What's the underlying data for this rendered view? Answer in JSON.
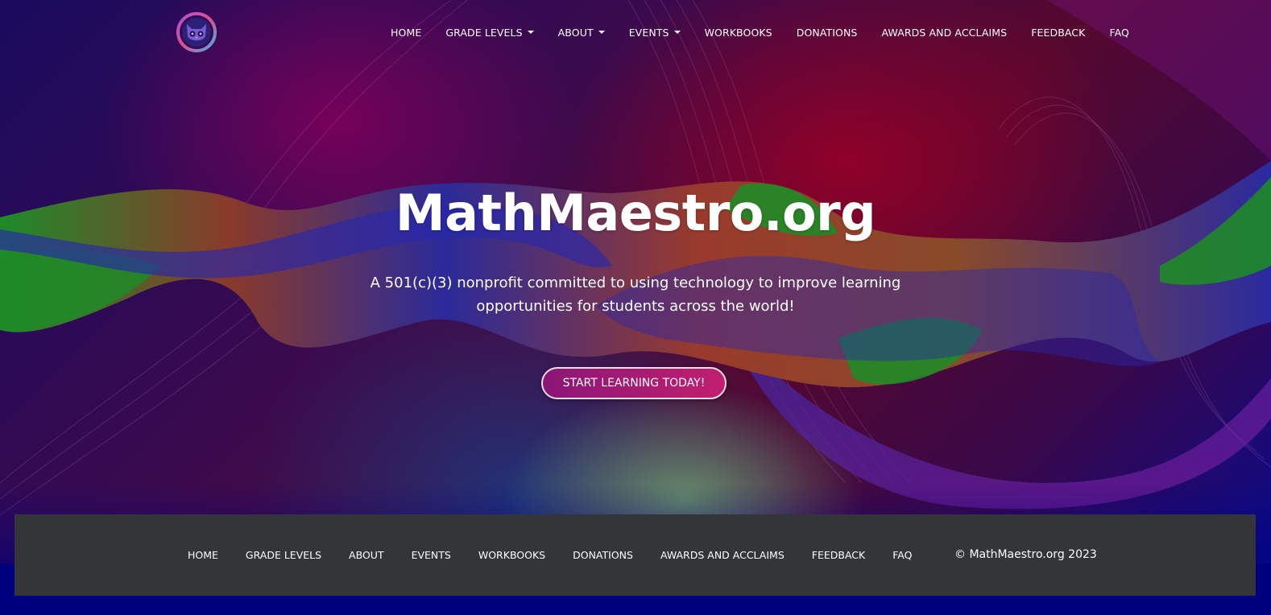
{
  "brand": {
    "logo_icon": "owl-logo-icon",
    "colors": {
      "accent": "#b3196f",
      "footer_bg": "#343538",
      "page_bg": "#00007f"
    }
  },
  "topnav": {
    "items": [
      {
        "label": "HOME",
        "dropdown": false
      },
      {
        "label": "GRADE LEVELS",
        "dropdown": true
      },
      {
        "label": "ABOUT",
        "dropdown": true
      },
      {
        "label": "EVENTS",
        "dropdown": true
      },
      {
        "label": "WORKBOOKS",
        "dropdown": false
      },
      {
        "label": "DONATIONS",
        "dropdown": false
      },
      {
        "label": "AWARDS AND ACCLAIMS",
        "dropdown": false
      },
      {
        "label": "FEEDBACK",
        "dropdown": false
      },
      {
        "label": "FAQ",
        "dropdown": false
      }
    ]
  },
  "hero": {
    "title": "MathMaestro.org",
    "subtitle": "A 501(c)(3) nonprofit committed to using technology to improve learning opportunities for students across the world!",
    "cta_label": "START LEARNING TODAY!"
  },
  "footer": {
    "items": [
      {
        "label": "HOME"
      },
      {
        "label": "GRADE LEVELS"
      },
      {
        "label": "ABOUT"
      },
      {
        "label": "EVENTS"
      },
      {
        "label": "WORKBOOKS"
      },
      {
        "label": "DONATIONS"
      },
      {
        "label": "AWARDS AND ACCLAIMS"
      },
      {
        "label": "FEEDBACK"
      },
      {
        "label": "FAQ"
      }
    ],
    "copyright": "© MathMaestro.org 2023"
  }
}
